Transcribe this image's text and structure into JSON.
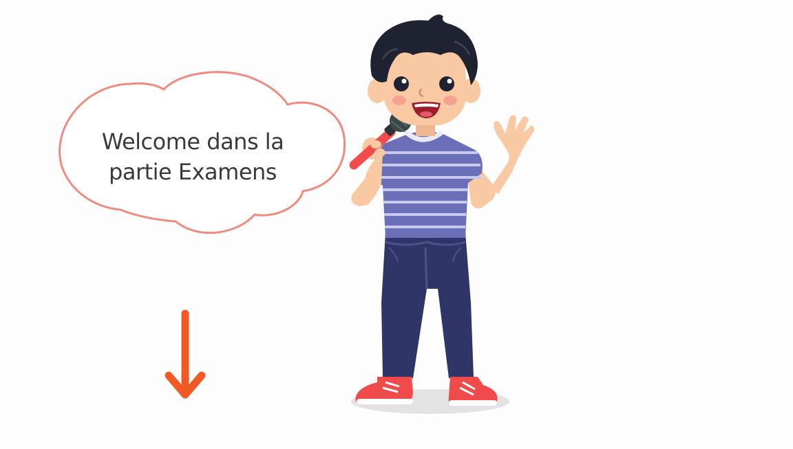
{
  "bubble": {
    "line1": "Welcome dans la",
    "line2": "partie Examens"
  },
  "colors": {
    "bubble_stroke": "#f08a7e",
    "arrow": "#f15a24",
    "shirt": "#6a6fb8",
    "shirt_stripe": "#c7c9ee",
    "pants": "#2f3566",
    "shoes": "#f04b4b",
    "skin": "#f9c9a4",
    "hair": "#1f2230",
    "mic_handle": "#f24b4b",
    "mic_head": "#3a4848"
  },
  "icons": [
    "down-arrow-icon",
    "microphone-icon"
  ]
}
